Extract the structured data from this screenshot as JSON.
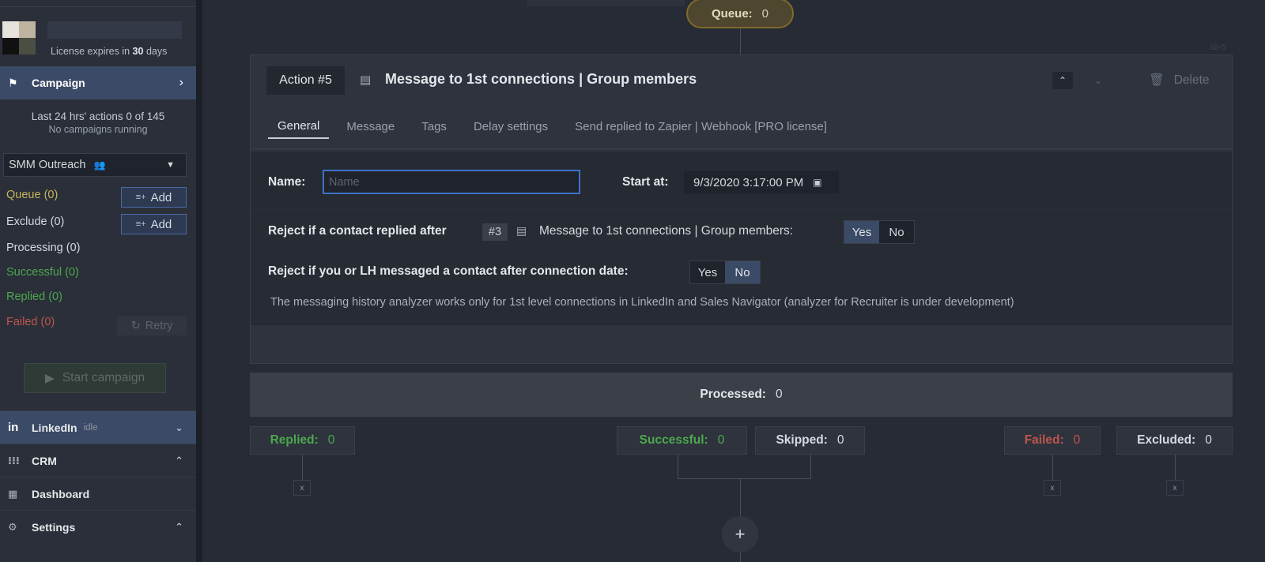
{
  "sidebar": {
    "license_prefix": "License expires in",
    "license_days": "30",
    "license_suffix": "days",
    "campaign_label": "Campaign",
    "actions_stat": "Last 24 hrs' actions 0 of 145",
    "no_campaigns": "No campaigns running",
    "campaign_name": "SMM Outreach",
    "queue": "Queue (0)",
    "exclude": "Exclude (0)",
    "processing": "Processing (0)",
    "successful": "Successful (0)",
    "replied": "Replied (0)",
    "failed": "Failed (0)",
    "add_label": "Add",
    "retry_label": "Retry",
    "start_label": "Start campaign",
    "linkedin_label": "LinkedIn",
    "linkedin_status": "idle",
    "crm_label": "CRM",
    "dashboard_label": "Dashboard",
    "settings_label": "Settings"
  },
  "flow": {
    "queue_label": "Queue:",
    "queue_value": "0",
    "id_note": "id=5",
    "processed_label": "Processed:",
    "processed_value": "0",
    "outcomes": {
      "replied_label": "Replied:",
      "replied_value": "0",
      "successful_label": "Successful:",
      "successful_value": "0",
      "skipped_label": "Skipped:",
      "skipped_value": "0",
      "failed_label": "Failed:",
      "failed_value": "0",
      "excluded_label": "Excluded:",
      "excluded_value": "0"
    },
    "x_label": "x",
    "add_symbol": "+"
  },
  "action": {
    "badge": "Action #5",
    "title": "Message to 1st connections | Group members",
    "delete_label": "Delete",
    "tabs": [
      "General",
      "Message",
      "Tags",
      "Delay settings",
      "Send replied to Zapier | Webhook [PRO license]"
    ],
    "name_label": "Name:",
    "name_placeholder": "Name",
    "start_label": "Start at:",
    "start_value": "9/3/2020 3:17:00 PM",
    "reject1_label": "Reject if a contact replied after",
    "reject1_ref": "#3",
    "reject1_text": "Message to 1st connections | Group members:",
    "reject2_label": "Reject if you or LH messaged a contact after connection date:",
    "yes": "Yes",
    "no": "No",
    "note": "The messaging history analyzer works only for 1st level connections in LinkedIn and Sales Navigator (analyzer for Recruiter is under development)"
  },
  "colors": {
    "accent": "#3b4a66",
    "queue": "#c9b35a",
    "success": "#4da84f",
    "failed": "#c0544d"
  }
}
